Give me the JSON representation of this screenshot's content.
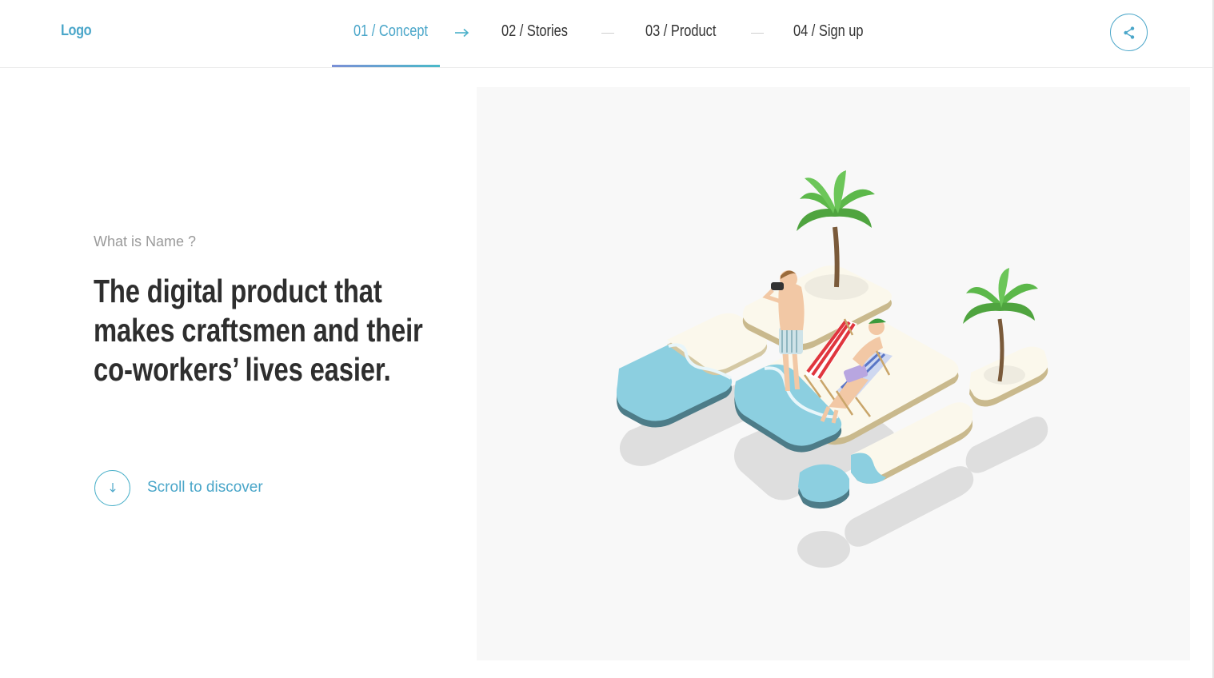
{
  "header": {
    "logo": "Logo",
    "nav": [
      {
        "label": "01 / Concept",
        "active": true
      },
      {
        "label": "02 / Stories",
        "active": false
      },
      {
        "label": "03 / Product",
        "active": false
      },
      {
        "label": "04 / Sign up",
        "active": false
      }
    ],
    "share_icon": "share-icon"
  },
  "hero": {
    "eyebrow": "What is Name ?",
    "headline_lines": [
      "The digital product that",
      "makes craftsmen and their",
      "co-workers’ lives easier."
    ],
    "scroll_label": "Scroll to discover",
    "scroll_icon": "arrow-down-icon"
  },
  "illustration": {
    "subject": "isometric beach islands with palm trees, sunbathers and deck chairs"
  },
  "colors": {
    "accent": "#4aa6c9",
    "text": "#2e2e2e",
    "muted": "#9a9a9a",
    "panel": "#f8f8f8",
    "water": "#8ccfe0",
    "sand": "#fbf8ec",
    "palm": "#5cb84a"
  }
}
